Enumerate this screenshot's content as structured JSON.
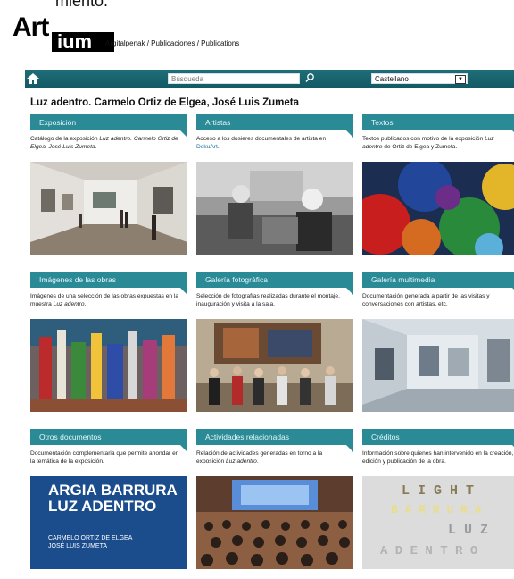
{
  "top_fragment": "miento.",
  "logo": {
    "part1": "Art",
    "part2": "ium"
  },
  "breadcrumb": "Argitalpenak / Publicaciones / Publications",
  "nav": {
    "search_placeholder": "Búsqueda",
    "language": "Castellano"
  },
  "page_title": "Luz adentro. Carmelo Ortiz de Elgea, José Luis Zumeta",
  "cards": [
    {
      "title": "Exposición",
      "desc_pre": "Catálogo de la exposición ",
      "desc_em": "Luz adentro. Carmelo Ortiz de Elgea, José Luis Zumeta",
      "desc_post": "."
    },
    {
      "title": "Artistas",
      "desc_pre": "Acceso a los dosieres documentales de artista en ",
      "desc_link": "DokuArt",
      "desc_post": "."
    },
    {
      "title": "Textos",
      "desc_pre": "Textos publicados con motivo de la exposición ",
      "desc_em": "Luz adentro",
      "desc_post": " de Ortiz de Elgea y Zumeta."
    },
    {
      "title": "Imágenes de las obras",
      "desc_pre": "Imágenes de una selección de las obras expuestas en la muestra ",
      "desc_em": "Luz adentro",
      "desc_post": "."
    },
    {
      "title": "Galería fotográfica",
      "desc_pre": "Selección de fotografías realizadas durante el montaje, inauguración y visita a la sala."
    },
    {
      "title": "Galería multimedia",
      "desc_pre": "Documentación generada a partir de las visitas y conversaciones con artistas, etc."
    },
    {
      "title": "Otros documentos",
      "desc_pre": "Documentación complementaria que permite ahondar en la temática de la exposición."
    },
    {
      "title": "Actividades relacionadas",
      "desc_pre": "Relación de actividades generadas en torno a la exposición ",
      "desc_em": "Luz adentro",
      "desc_post": "."
    },
    {
      "title": "Créditos",
      "desc_pre": "Información sobre quienes han intervenido en la creación, edición y publicación de la obra."
    }
  ],
  "poster": {
    "line1": "ARGIA BARRURA",
    "line2": "LUZ ADENTRO",
    "line3": "CARMELO ORTIZ DE ELGEA",
    "line4": "JOSÉ LUIS ZUMETA"
  },
  "credits_art": {
    "word1": "L I G H T",
    "word2": "B A R R U R A",
    "word3": "L U Z",
    "word4": "A D E N T R O"
  },
  "colors": {
    "nav": "#1f6e79",
    "card_header": "#2a8a96",
    "poster_bg": "#1b4c8c"
  }
}
